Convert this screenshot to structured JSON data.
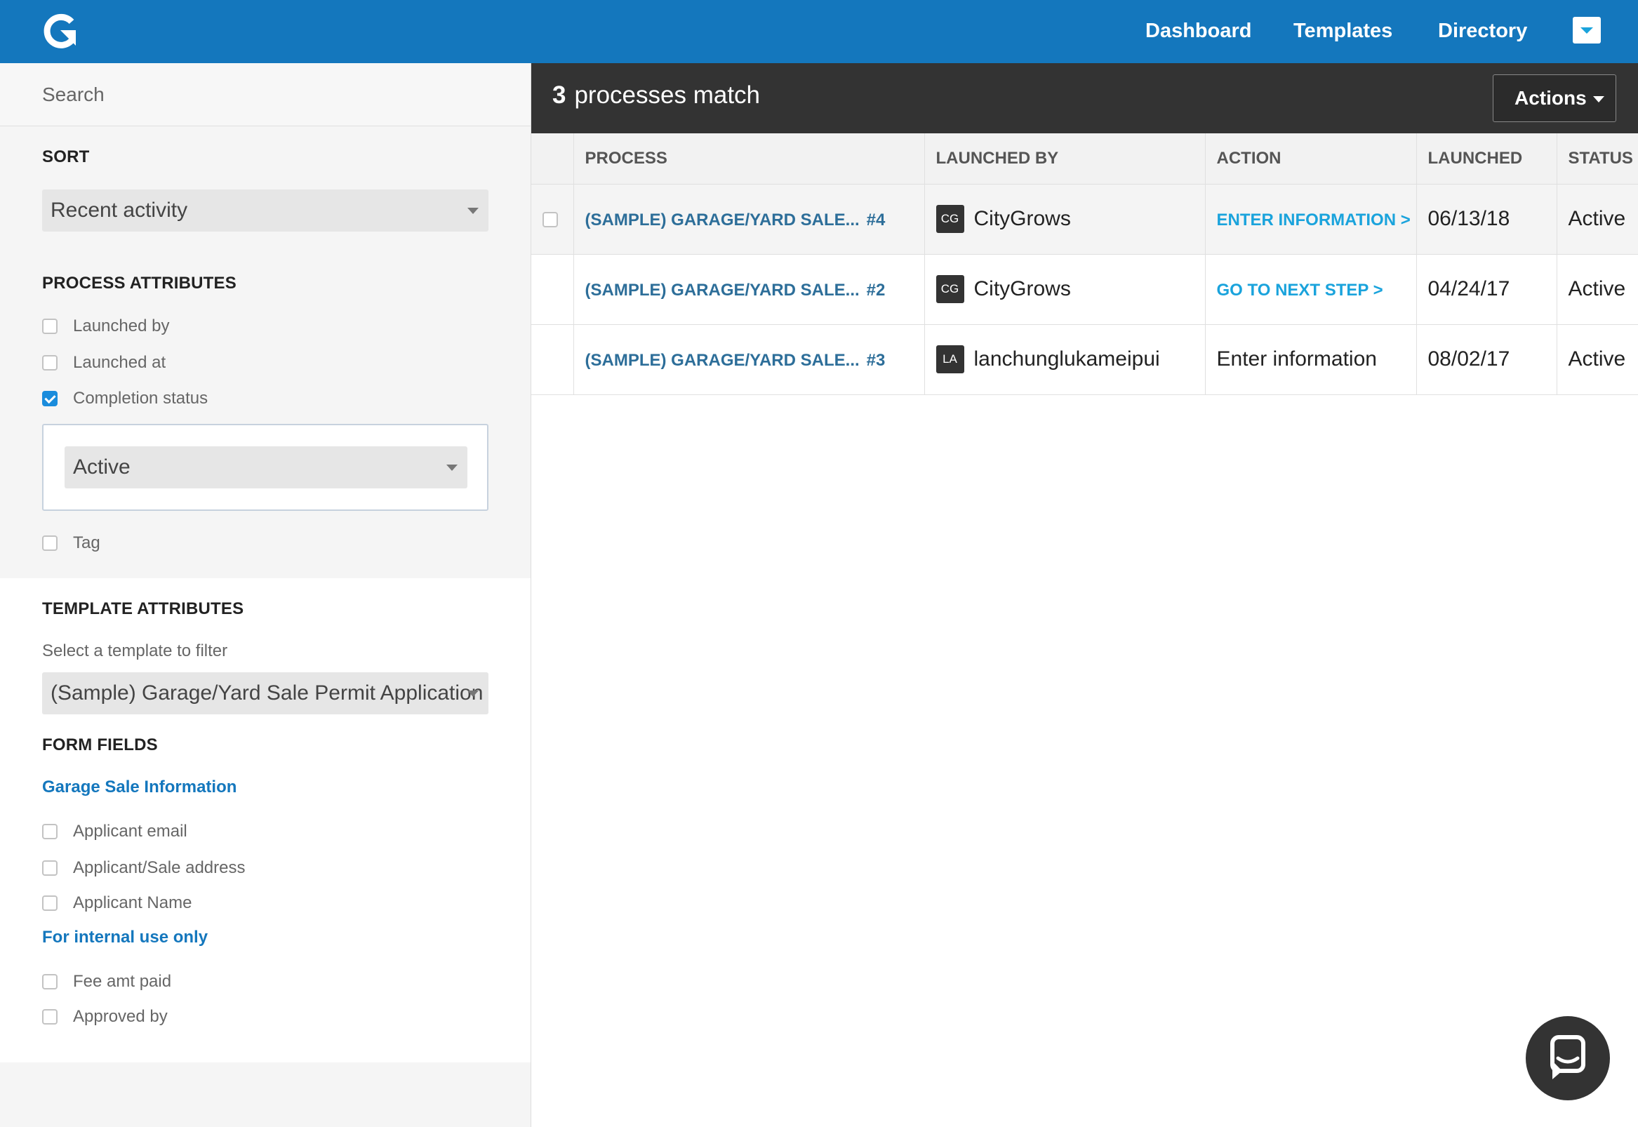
{
  "nav": {
    "logo_icon": "circular-arrow-logo-icon",
    "links": [
      "Dashboard",
      "Templates",
      "Directory"
    ],
    "dropdown_icon": "chevron-down-icon",
    "bar_color": "#1477bd"
  },
  "sidebar": {
    "search_placeholder": "Search",
    "sort": {
      "title": "SORT",
      "selected": "Recent activity"
    },
    "process_attributes": {
      "title": "PROCESS ATTRIBUTES",
      "launched_by": "Launched by",
      "launched_at": "Launched at",
      "completion_status": "Completion status",
      "completion_status_checked": true,
      "status_selected": "Active",
      "tag": "Tag"
    },
    "template_attributes": {
      "title": "TEMPLATE ATTRIBUTES",
      "helper": "Select a template to filter",
      "template_selected": "(Sample) Garage/Yard Sale Permit Application"
    },
    "form_fields": {
      "title": "FORM FIELDS",
      "group1": "Garage Sale Information",
      "applicant_email": "Applicant email",
      "applicant_address": "Applicant/Sale address",
      "applicant_name": "Applicant Name",
      "group2": "For internal use only",
      "fee_amt_paid": "Fee amt paid",
      "approved_by": "Approved by"
    }
  },
  "main": {
    "match_count": "3",
    "match_suffix": "processes match",
    "actions_label": "Actions",
    "columns": {
      "process": "PROCESS",
      "launched_by": "LAUNCHED BY",
      "action": "ACTION",
      "launched": "LAUNCHED",
      "status": "STATUS"
    },
    "rows": [
      {
        "process": "(SAMPLE) GARAGE/YARD SALE...",
        "number": "#4",
        "avatar": "CG",
        "user": "CityGrows",
        "action": "ENTER INFORMATION >",
        "launched": "06/13/18",
        "status": "Active"
      },
      {
        "process": "(SAMPLE) GARAGE/YARD SALE...",
        "number": "#2",
        "avatar": "CG",
        "user": "CityGrows",
        "action": "GO TO NEXT STEP >",
        "launched": "04/24/17",
        "status": "Active"
      },
      {
        "process": "(SAMPLE) GARAGE/YARD SALE...",
        "number": "#3",
        "avatar": "LA",
        "user": "lanchunglukameipui",
        "action": "Enter information",
        "launched": "08/02/17",
        "status": "Active"
      }
    ]
  },
  "chat": {
    "icon": "chat-bubble-icon"
  }
}
